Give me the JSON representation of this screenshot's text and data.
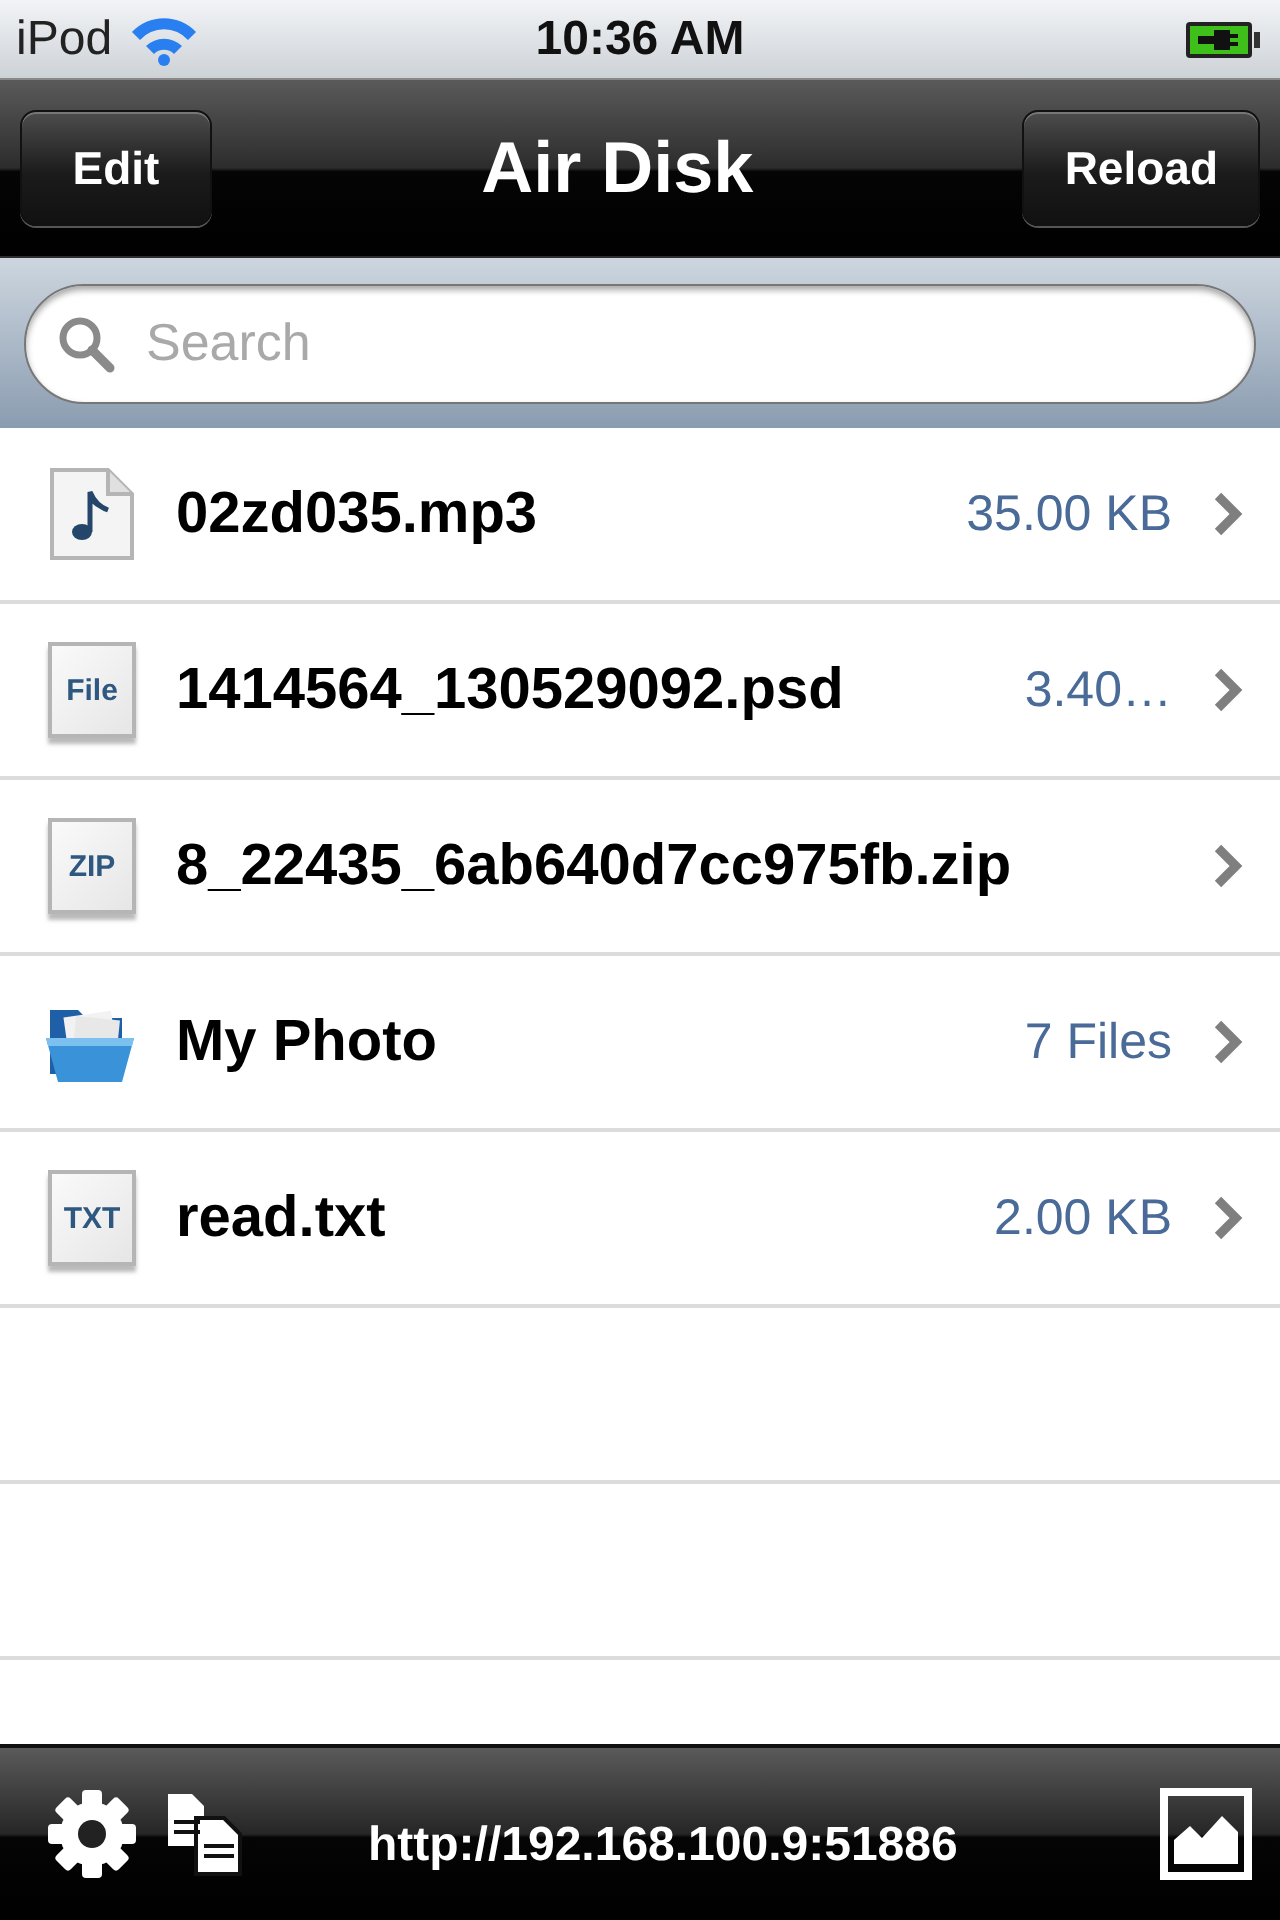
{
  "status_bar": {
    "carrier": "iPod",
    "time": "10:36 AM",
    "charging": true
  },
  "nav_bar": {
    "title": "Air Disk",
    "left_button": "Edit",
    "right_button": "Reload"
  },
  "search": {
    "placeholder": "Search"
  },
  "files": [
    {
      "kind": "audio",
      "name": "02zd035.mp3",
      "detail": "35.00 KB"
    },
    {
      "kind": "document",
      "icon_label": "File",
      "name": "1414564_130529092.psd",
      "detail": "3.40…"
    },
    {
      "kind": "document",
      "icon_label": "ZIP",
      "name": "8_22435_6ab640d7cc975fb.zip"
    },
    {
      "kind": "folder",
      "name": "My Photo",
      "detail": "7 Files"
    },
    {
      "kind": "document",
      "icon_label": "TXT",
      "name": "read.txt",
      "detail": "2.00 KB"
    }
  ],
  "toolbar": {
    "address": "http://192.168.100.9:51886"
  }
}
